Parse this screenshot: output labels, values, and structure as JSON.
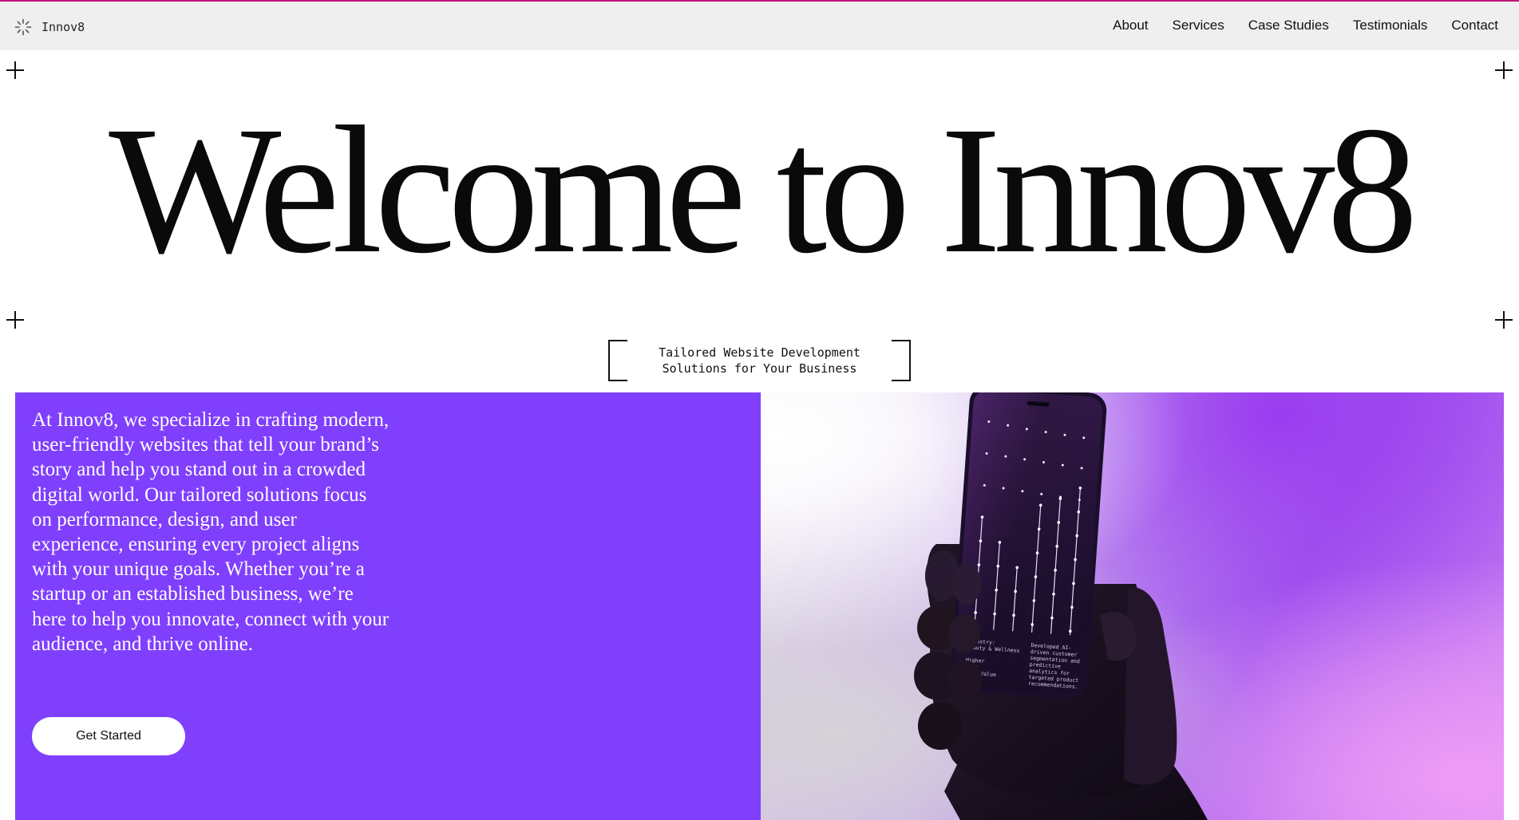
{
  "nav": {
    "brand_name": "Innov8",
    "links": [
      "About",
      "Services",
      "Case Studies",
      "Testimonials",
      "Contact"
    ]
  },
  "hero": {
    "title": "Welcome to Innov8",
    "tagline_line1": "Tailored Website Development",
    "tagline_line2": "Solutions for Your Business"
  },
  "intro": {
    "text": "At Innov8, we specialize in crafting modern, user-friendly websites that tell your brand’s story and help you stand out in a crowded digital world. Our tailored solutions focus on performance, design, and user experience, ensuring every project aligns with your unique goals. Whether you’re a startup or an established business, we’re here to help you innovate, connect with your audience, and thrive online.",
    "cta_label": "Get Started"
  },
  "phone_screen": {
    "left_label_1": "Industry:",
    "left_label_2": "Beauty & Wellness",
    "left_label_3": "Higher",
    "left_label_4": "omer",
    "left_label_5": "time Value",
    "right_label_1": "Developed AI-",
    "right_label_2": "driven customer",
    "right_label_3": "segmentation and",
    "right_label_4": "predictive",
    "right_label_5": "analytics for",
    "right_label_6": "targeted product",
    "right_label_7": "recommendations."
  },
  "colors": {
    "accent_purple": "#7f3ffd",
    "top_line": "#c0167a",
    "nav_background": "#efefef"
  },
  "icons": {
    "brand": "spinner-burst-icon",
    "crosshair": "plus-crosshair-icon"
  }
}
